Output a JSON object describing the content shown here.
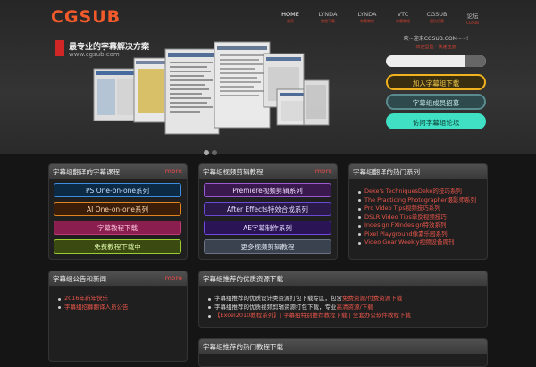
{
  "brand": {
    "logo": "CGSUB"
  },
  "nav": [
    {
      "label": "HOME",
      "sub": "首页"
    },
    {
      "label": "LYNDA",
      "sub": "教程下载"
    },
    {
      "label": "LYNDA",
      "sub": "字幕教程"
    },
    {
      "label": "VTC",
      "sub": "字幕教程"
    },
    {
      "label": "CGSUB",
      "sub": "团队招募"
    },
    {
      "label": "论坛",
      "sub": "CGSUB"
    }
  ],
  "slider": {
    "headline": "最专业的字幕解决方案",
    "url": "www.cgsub.com",
    "dots_total": 2,
    "dots_active": 1
  },
  "aside": {
    "welcome": "欢~迎来CGSUB.COM~~!",
    "links": "欢迎登陆 · 快速注册",
    "buttons": [
      "加入字幕组下载",
      "字幕组成员招募",
      "访问字幕组论坛"
    ]
  },
  "panels": {
    "lynda": {
      "title": "字幕组翻译的字幕课程",
      "more": "more",
      "buttons": [
        "PS One-on-one系列",
        "AI One-on-one系列",
        "字幕教程下载",
        "免费教程下载中"
      ]
    },
    "video": {
      "title": "字幕组视频剪辑教程",
      "more": "more",
      "buttons": [
        "Premiere视频剪辑系列",
        "After Effects特效合成系列",
        "AE字幕制作系列",
        "更多视频剪辑教程"
      ]
    },
    "series": {
      "title": "字幕组翻译的热门系列",
      "items": [
        "Deke's TechniquesDeke的技巧系列",
        "The Practicing Photographer摄影师系列",
        "Pro Video Tips视频技巧系列",
        "DSLR Video Tips单反视频技巧",
        "Indesign FXIndesign特效系列",
        "Pixel Playground像素乐园系列",
        "Video Gear Weekly视频设备周刊"
      ]
    },
    "news": {
      "title": "字幕组公告和新闻",
      "more": "more",
      "items": [
        "2016年新年快乐",
        "字幕组招募翻译人员公告"
      ]
    },
    "recommend": {
      "title": "字幕组推荐的优质资源下载",
      "items": [
        {
          "text": "字幕组推荐的优质设计类资源打包下载专区，包含",
          "link": "免费资源/付费资源下载"
        },
        {
          "text": "字幕组推荐的优质视频剪辑资源打包下载，专业",
          "link": "高清资源/下载"
        },
        {
          "text": "",
          "link": "【Excel2010教程系列】| 字幕组特别推荐教程下载 | 全套办公软件教程下载"
        }
      ]
    },
    "bottom": {
      "title": "字幕组推荐的热门教程下载"
    }
  },
  "colors": {
    "accent": "#f25a2b",
    "link": "#e24a4a",
    "list_link": "#e8554a"
  }
}
